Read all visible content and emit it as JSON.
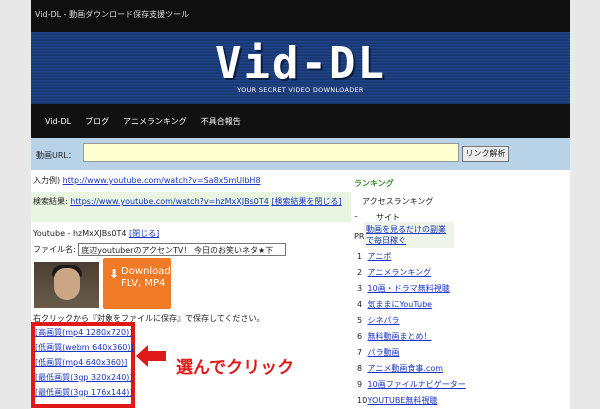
{
  "header": {
    "title": "Vid-DL - 動画ダウンロード保存支援ツール"
  },
  "banner": {
    "logo": "Vid-DL",
    "tagline": "YOUR SECRET VIDEO DOWNLOADER"
  },
  "nav": {
    "items": [
      "Vid-DL",
      "ブログ",
      "アニメランキング",
      "不具合報告"
    ]
  },
  "url_form": {
    "label": "動画URL：",
    "value": "",
    "button": "リンク解析"
  },
  "example": {
    "label": "入力例)",
    "url": "http://www.youtube.com/watch?v=Sa8x5mUlbH8"
  },
  "search": {
    "label": "検索結果:",
    "url": "https://www.youtube.com/watch?v=hzMxXJBs0T4",
    "close": "[検索結果を閉じる]"
  },
  "video": {
    "line": "Youtube - hzMxXJBs0T4",
    "close": "[閉じる]",
    "filename_label": "ファイル名:",
    "filename": "底辺youtuberのアクセンTV！ 今日のお笑いネタ★下"
  },
  "download_button": {
    "line1": "Download",
    "line2": "FLV, MP4"
  },
  "instructions": "右クリックから『対象をファイルに保存』で保存してください。",
  "formats": [
    "[高画質(mp4 1280x720)]",
    "[低画質(webm 640x360)]",
    "[低画質(mp4 640x360)]",
    "[最低画質(3gp 320x240)]",
    "[最低画質(3gp 176x144)]"
  ],
  "callout": "選んでクリック",
  "sidebar": {
    "title": "ランキング",
    "subtitle": "アクセスランキング",
    "col_site": "サイト",
    "pr": "PR",
    "pr_item": "動画を見るだけの副業で毎日稼ぐ",
    "items": [
      {
        "n": "1",
        "label": "アニポ"
      },
      {
        "n": "2",
        "label": "アニメランキング"
      },
      {
        "n": "3",
        "label": "10画・ドラマ無料視聴"
      },
      {
        "n": "4",
        "label": "気ままにYouTube"
      },
      {
        "n": "5",
        "label": "シネパラ"
      },
      {
        "n": "6",
        "label": "無料動画まとめ！"
      },
      {
        "n": "7",
        "label": "パラ動画"
      },
      {
        "n": "8",
        "label": "アニメ動画食事.com"
      },
      {
        "n": "9",
        "label": "10画ファイルナビゲーター"
      },
      {
        "n": "10",
        "label": "YOUTUBE無料視聴"
      }
    ]
  },
  "colors": {
    "accent": "#e01818",
    "button": "#f07a26",
    "banner": "#1b3a78"
  }
}
